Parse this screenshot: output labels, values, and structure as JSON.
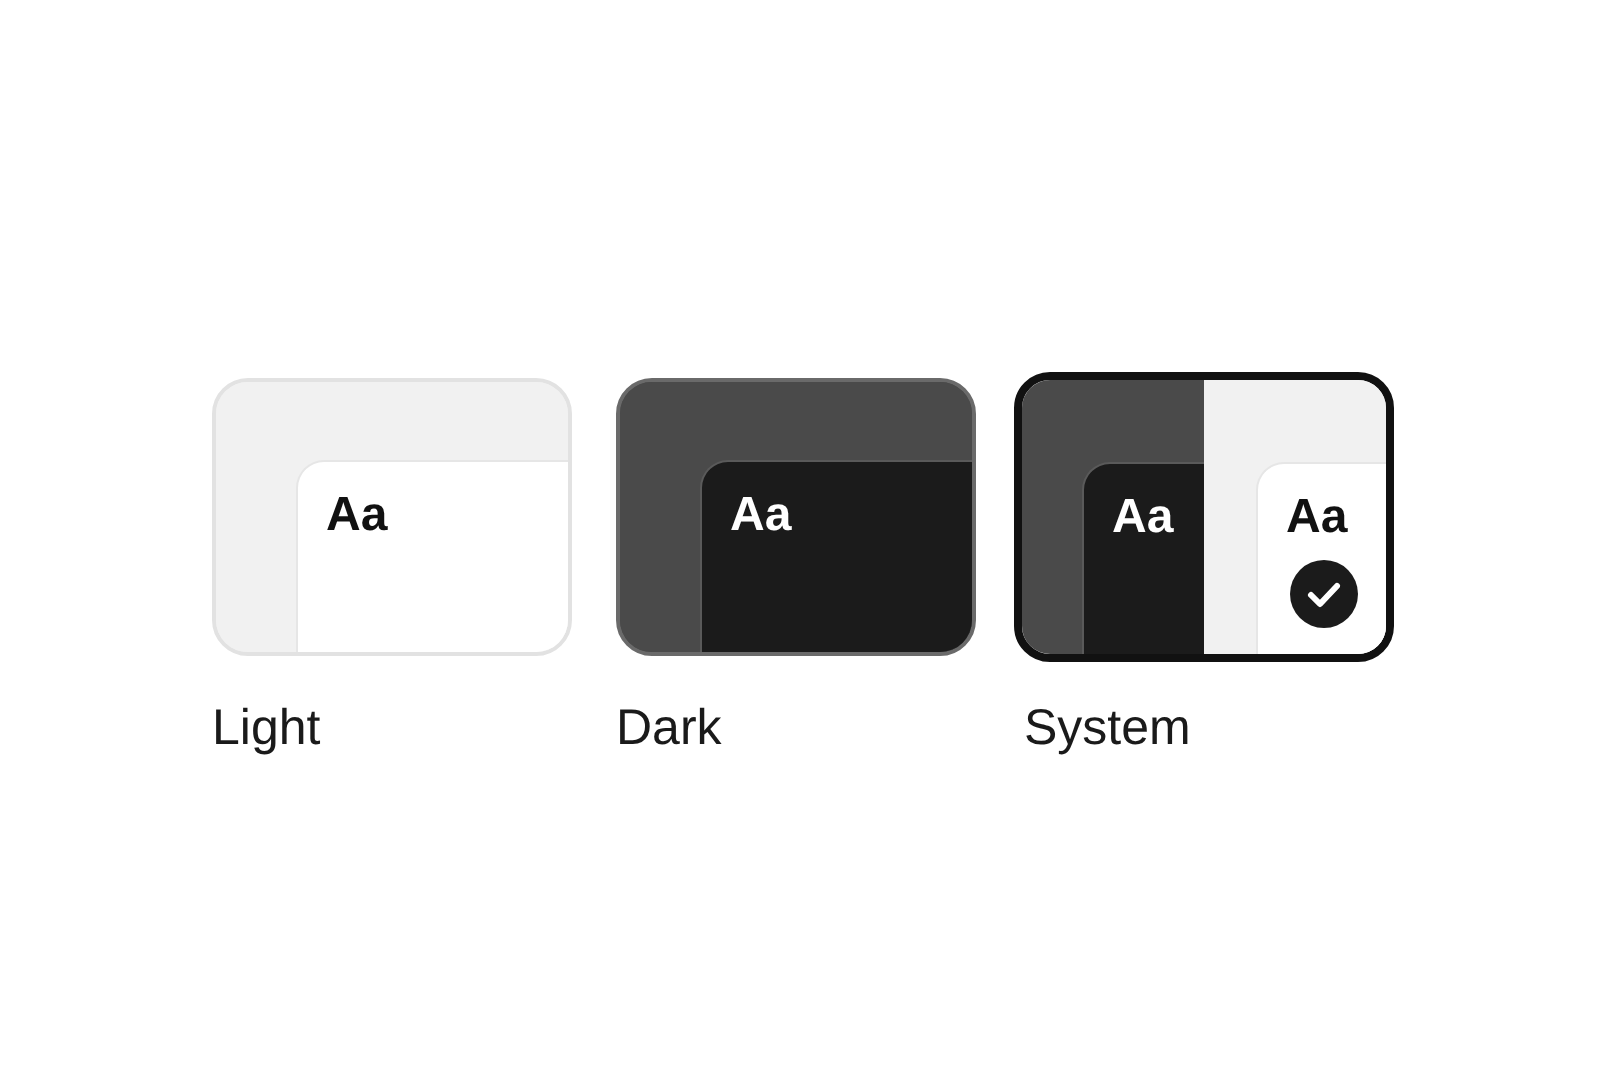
{
  "theme_options": [
    {
      "kind": "light",
      "label": "Light",
      "samples": [
        "Aa"
      ],
      "selected": false
    },
    {
      "kind": "dark",
      "label": "Dark",
      "samples": [
        "Aa"
      ],
      "selected": false
    },
    {
      "kind": "system",
      "label": "System",
      "samples": [
        "Aa",
        "Aa"
      ],
      "selected": true
    }
  ]
}
